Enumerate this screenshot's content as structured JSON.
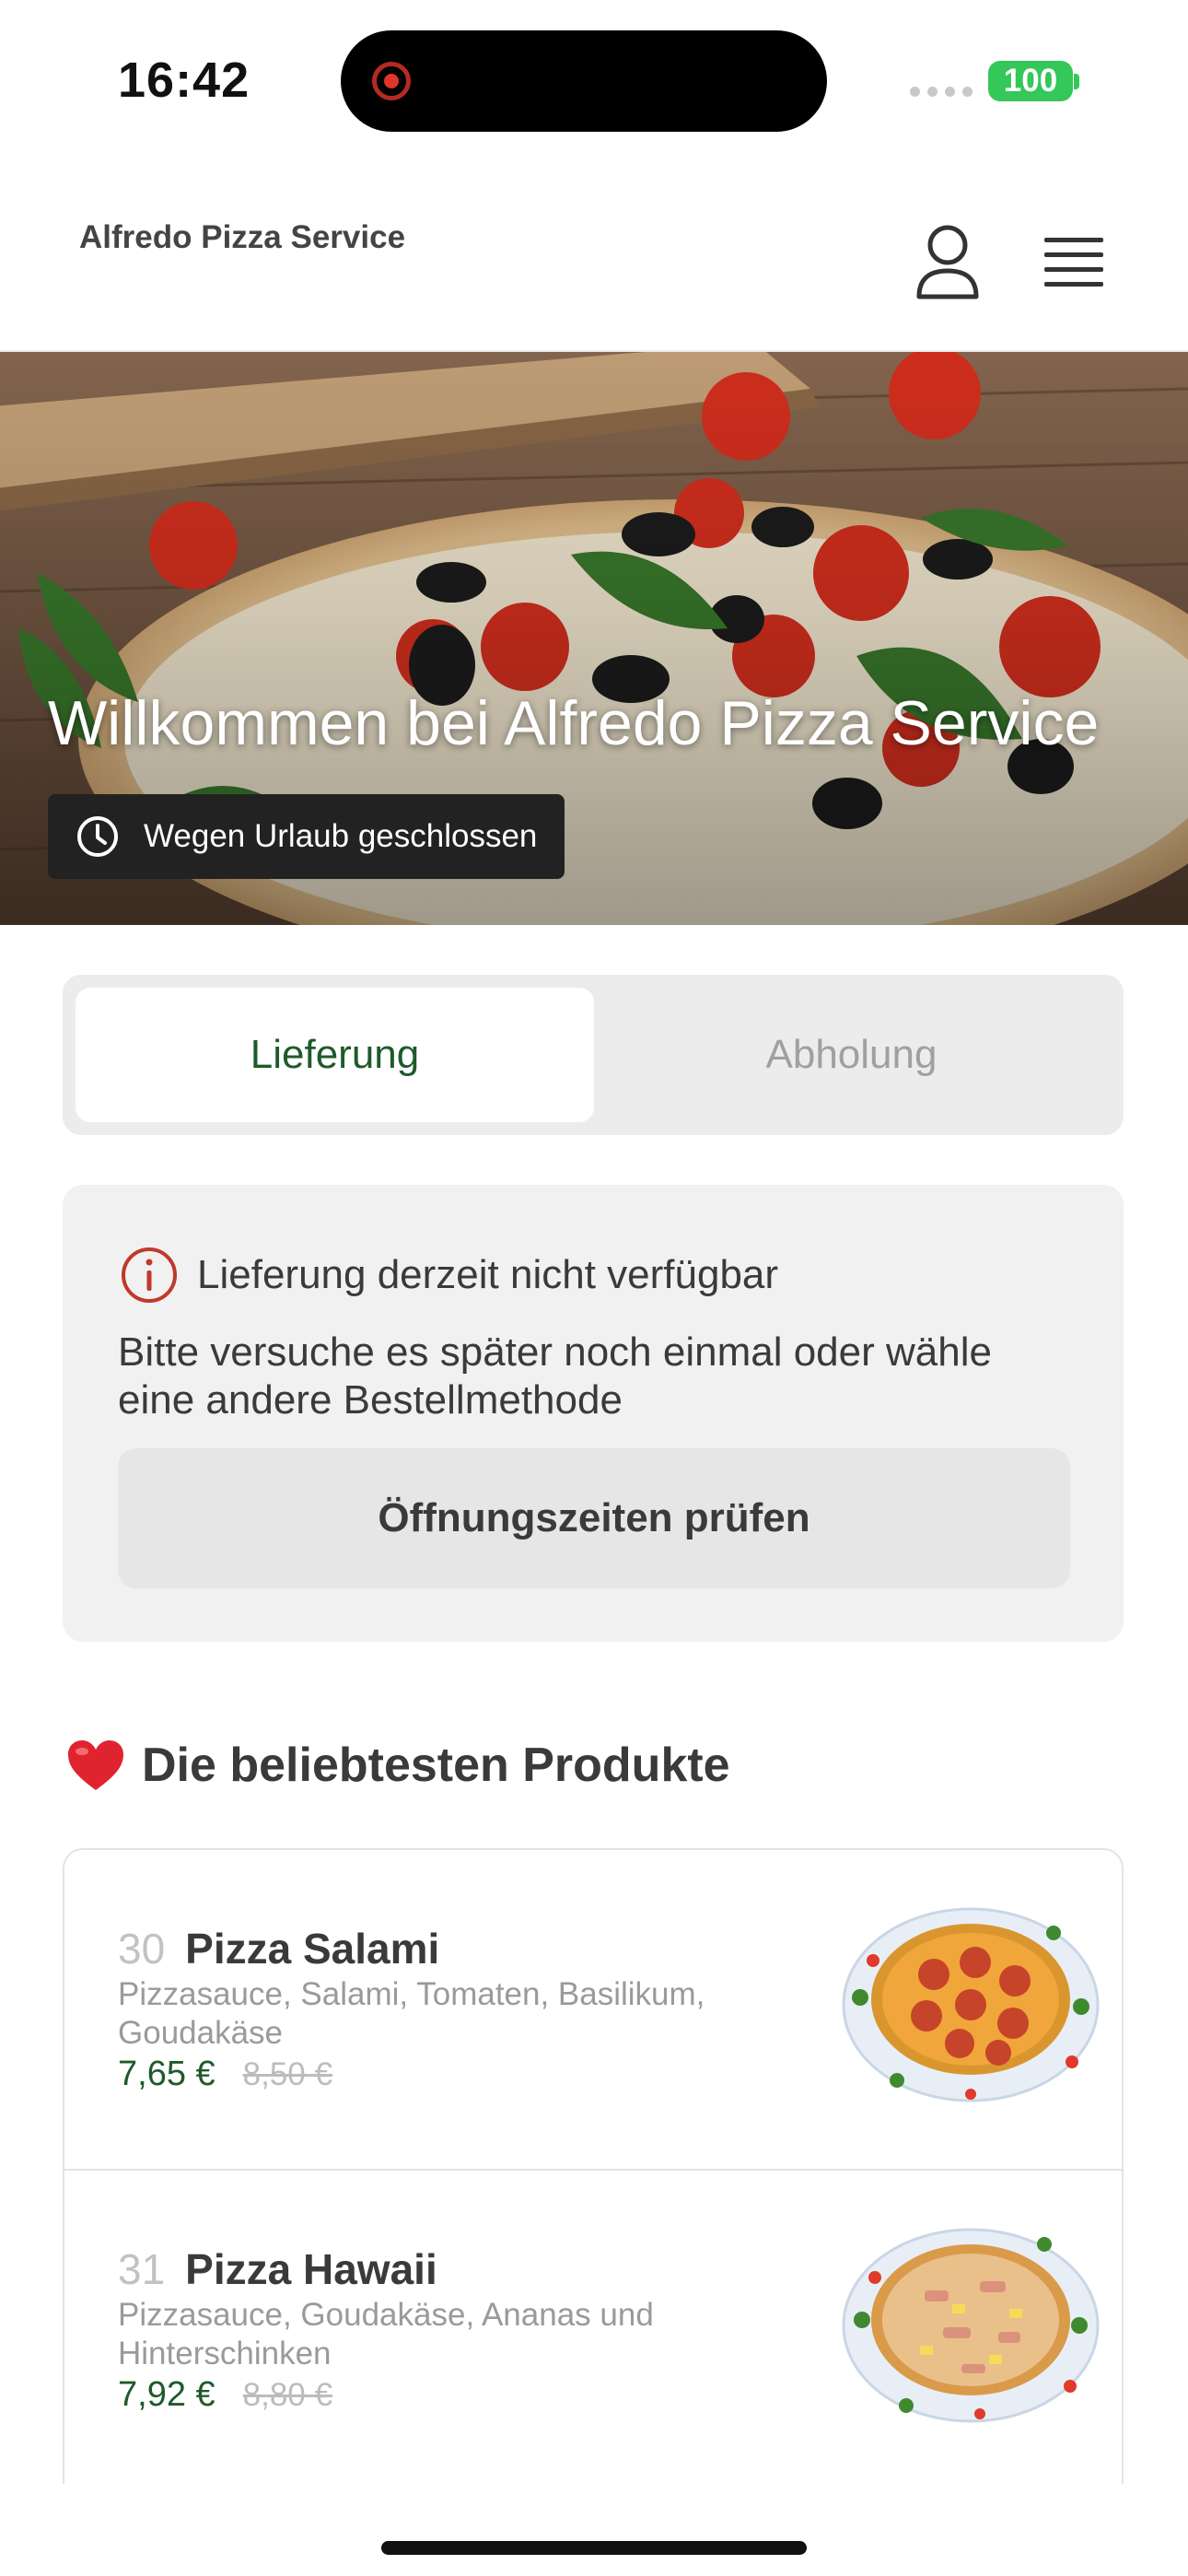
{
  "status_bar": {
    "time": "16:42",
    "battery": "100",
    "battery_color": "#34c759",
    "recording_color": "#e0352b"
  },
  "header": {
    "brand": "Alfredo Pizza Service",
    "icons": [
      "user-icon",
      "hamburger-menu-icon"
    ]
  },
  "hero": {
    "title": "Willkommen bei Alfredo Pizza Service",
    "status_badge": "Wegen Urlaub geschlossen",
    "status_icon": "clock-icon"
  },
  "tabs": {
    "delivery": "Lieferung",
    "pickup": "Abholung",
    "active_color": "#1e5a2b"
  },
  "notice": {
    "icon": "info-circle-icon",
    "title": "Lieferung derzeit nicht verfügbar",
    "text": "Bitte versuche es später noch einmal oder wähle eine andere Bestellmethode",
    "button": "Öffnungszeiten prüfen"
  },
  "popular": {
    "icon": "heart-icon",
    "title": "Die beliebtesten Produkte"
  },
  "products": [
    {
      "number": "30",
      "name": "Pizza Salami",
      "description": "Pizzasauce, Salami, Tomaten, Basilikum, Goudakäse",
      "price": "7,65 €",
      "old_price": "8,50 €"
    },
    {
      "number": "31",
      "name": "Pizza Hawaii",
      "description": "Pizzasauce, Goudakäse, Ananas und Hinterschinken",
      "price": "7,92 €",
      "old_price": "8,80 €"
    }
  ]
}
